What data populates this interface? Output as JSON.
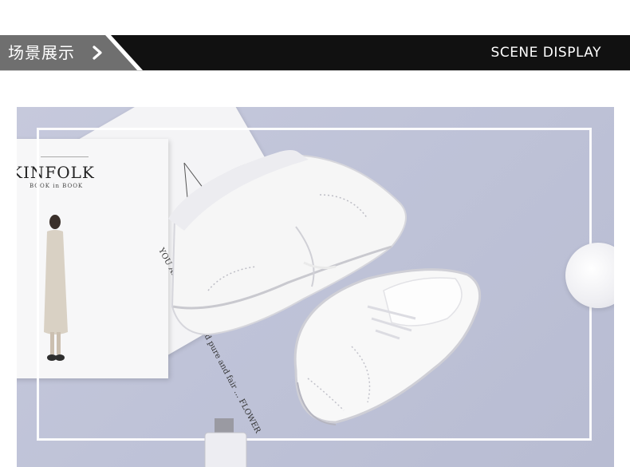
{
  "header": {
    "title_cn": "场景展示",
    "chevron_icon": "chevron-right-icon",
    "title_en": "SCENE DISPLAY",
    "colors": {
      "dark": "#111111",
      "grey": "#6f6f6f"
    }
  },
  "scene": {
    "magazine_title": "KINFOLK",
    "magazine_subtitle": "BOOK in BOOK",
    "page_text": "YOU ALL ... so sweet and pure and fair ... FLOWER"
  }
}
